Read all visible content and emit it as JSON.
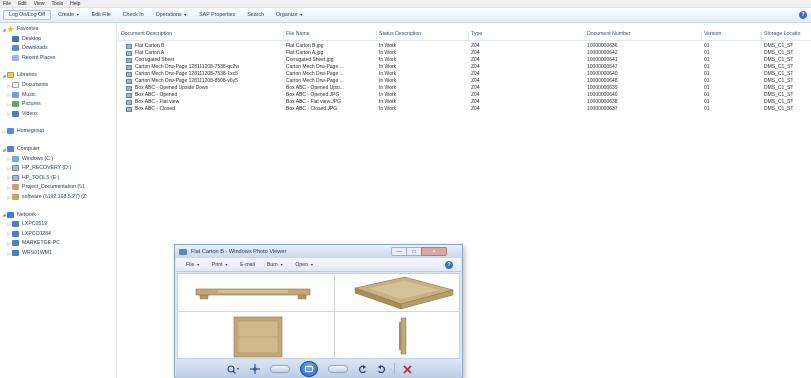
{
  "menu": [
    "File",
    "Edit",
    "View",
    "Tools",
    "Help"
  ],
  "toolbar": {
    "items": [
      {
        "label": "Log On/Log Off",
        "boxed": true,
        "caret": false
      },
      {
        "label": "Create",
        "boxed": false,
        "caret": true
      },
      {
        "label": "Edit File",
        "boxed": false,
        "caret": false
      },
      {
        "label": "Check In",
        "boxed": false,
        "caret": false
      },
      {
        "label": "Operations",
        "boxed": false,
        "caret": true
      },
      {
        "label": "SAP Properties",
        "boxed": false,
        "caret": false
      },
      {
        "label": "Search",
        "boxed": false,
        "caret": false
      },
      {
        "label": "Organize",
        "boxed": false,
        "caret": true
      }
    ],
    "help_icon": "help-icon"
  },
  "nav": [
    {
      "label": "Favorites",
      "icon": "star",
      "indent": 0,
      "expander": "◢",
      "header": true
    },
    {
      "label": "Desktop",
      "icon": "desk",
      "indent": 1
    },
    {
      "label": "Downloads",
      "icon": "down",
      "indent": 1
    },
    {
      "label": "Recent Places",
      "icon": "rec",
      "indent": 1
    },
    {
      "label": "",
      "icon": "",
      "indent": 0,
      "spacer": true
    },
    {
      "label": "Libraries",
      "icon": "lib",
      "indent": 0,
      "expander": "◢",
      "header": true
    },
    {
      "label": "Documents",
      "icon": "doc",
      "indent": 1,
      "expander": "▷"
    },
    {
      "label": "Music",
      "icon": "music",
      "indent": 1,
      "expander": "▷"
    },
    {
      "label": "Pictures",
      "icon": "pic",
      "indent": 1,
      "expander": "▷"
    },
    {
      "label": "Videos",
      "icon": "vid",
      "indent": 1,
      "expander": "▷"
    },
    {
      "label": "",
      "icon": "",
      "indent": 0,
      "spacer": true
    },
    {
      "label": "Homegroup",
      "icon": "home",
      "indent": 0,
      "expander": "▷",
      "header": true
    },
    {
      "label": "",
      "icon": "",
      "indent": 0,
      "spacer": true
    },
    {
      "label": "Computer",
      "icon": "comp",
      "indent": 0,
      "expander": "◢",
      "header": true
    },
    {
      "label": "Windows (C:)",
      "icon": "drivew",
      "indent": 1,
      "expander": "▷"
    },
    {
      "label": "HP_RECOVERY (D:)",
      "icon": "drive",
      "indent": 1,
      "expander": "▷"
    },
    {
      "label": "HP_TOOLS (E:)",
      "icon": "drive",
      "indent": 1,
      "expander": "▷"
    },
    {
      "label": "Project_Documentation (\\\\1",
      "icon": "share",
      "indent": 1,
      "expander": "▷"
    },
    {
      "label": "software (\\\\192.168.5.27) (Z:",
      "icon": "share",
      "indent": 1,
      "expander": "▷"
    },
    {
      "label": "",
      "icon": "",
      "indent": 0,
      "spacer": true
    },
    {
      "label": "Network",
      "icon": "net",
      "indent": 0,
      "expander": "◢",
      "header": true
    },
    {
      "label": "LXPC0519",
      "icon": "pc",
      "indent": 1,
      "expander": "▷"
    },
    {
      "label": "LXPCC0284",
      "icon": "pc",
      "indent": 1,
      "expander": "▷"
    },
    {
      "label": "MARKETGE-PC",
      "icon": "pc",
      "indent": 1,
      "expander": "▷"
    },
    {
      "label": "WRS01WM1",
      "icon": "pc",
      "indent": 1,
      "expander": "▷"
    }
  ],
  "columns": [
    "Document Description",
    "File Name",
    "Status Description",
    "Type",
    "Document Number",
    "Version",
    "Storage Locatio"
  ],
  "rows": [
    [
      "Flat Carton B",
      "Flat Carton B.jpg",
      "In Work",
      "Z04",
      "10000000636",
      "01",
      "DMS_C1_ST"
    ],
    [
      "Flat Carton A",
      "Flat Carton A.jpg",
      "In Work",
      "Z04",
      "10000000642",
      "01",
      "DMS_C1_ST"
    ],
    [
      "Corrugated Sheet",
      "Corrugated Sheet.jpg",
      "In Work",
      "Z04",
      "10000000641",
      "01",
      "DMS_C1_ST"
    ],
    [
      "Carton Mech Drw-Page 128111208-7538-qc2w",
      "Carton Mech Drw-Page ...",
      "In Work",
      "Z04",
      "10000000647",
      "01",
      "DMS_C1_ST"
    ],
    [
      "Carton Mech Drw-Page 128111208-7538-1xc5",
      "Carton Mech Drw-Page ...",
      "In Work",
      "Z04",
      "10000000640",
      "01",
      "DMS_C1_ST"
    ],
    [
      "Carton Mech Drw-Page 128111208-8508-v6y5",
      "Carton Mech Drw-Page ...",
      "In Work",
      "Z04",
      "10000000648",
      "01",
      "DMS_C1_ST"
    ],
    [
      "Box ABC - Opened Upside Down",
      "Box ABC - Opened Upsi...",
      "In Work",
      "Z04",
      "10000000639",
      "01",
      "DMS_C1_ST"
    ],
    [
      "Box ABC - Opened",
      "Box ABC - Opened.JPG",
      "In Work",
      "Z04",
      "10000000640",
      "01",
      "DMS_C1_ST"
    ],
    [
      "Box ABC - Flat view",
      "Box ABC - Flat view.JPG",
      "In Work",
      "Z04",
      "10000000638",
      "01",
      "DMS_C1_ST"
    ],
    [
      "Box ABC - Closed",
      "Box ABC - Closed.JPG",
      "In Work",
      "Z04",
      "10000000637",
      "01",
      "DMS_C1_ST"
    ]
  ],
  "viewer": {
    "title": "Flat Carton B - Windows Photo Viewer",
    "menu": [
      {
        "label": "File",
        "caret": true
      },
      {
        "label": "Print",
        "caret": true
      },
      {
        "label": "E-mail",
        "caret": false
      },
      {
        "label": "Burn",
        "caret": true
      },
      {
        "label": "Open",
        "caret": true
      }
    ],
    "controls": {
      "minimize": "—",
      "maximize": "□",
      "close": "✕"
    },
    "carton_color": "#c2a878",
    "carton_edge": "#8c7448"
  }
}
